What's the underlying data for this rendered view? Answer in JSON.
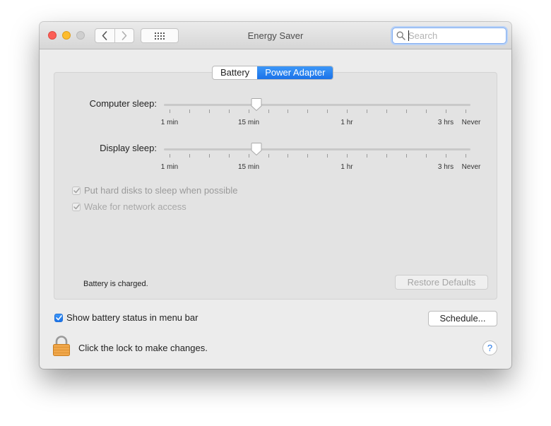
{
  "window": {
    "title": "Energy Saver"
  },
  "search": {
    "placeholder": "Search",
    "value": ""
  },
  "tabs": [
    {
      "label": "Battery",
      "selected": false
    },
    {
      "label": "Power Adapter",
      "selected": true
    }
  ],
  "computer_sleep": {
    "label": "Computer sleep:",
    "tick_labels": [
      "1 min",
      "15 min",
      "1 hr",
      "3 hrs",
      "Never"
    ],
    "value": "15 min"
  },
  "display_sleep": {
    "label": "Display sleep:",
    "tick_labels": [
      "1 min",
      "15 min",
      "1 hr",
      "3 hrs",
      "Never"
    ],
    "value": "15 min"
  },
  "options": [
    {
      "label": "Put hard disks to sleep when possible",
      "checked": true,
      "enabled": false
    },
    {
      "label": "Wake for network access",
      "checked": true,
      "enabled": false
    }
  ],
  "status_text": "Battery is charged.",
  "restore_defaults_label": "Restore Defaults",
  "show_battery_status": {
    "label": "Show battery status in menu bar",
    "checked": true
  },
  "schedule_label": "Schedule...",
  "lock_text": "Click the lock to make changes.",
  "help_label": "?",
  "colors": {
    "accent": "#1b72e8",
    "close": "#fc5f57",
    "minimize": "#fdbc2e",
    "zoom": "#cfcfcf"
  },
  "icons": [
    "back-icon",
    "forward-icon",
    "grid-icon",
    "search-icon",
    "checkmark-icon",
    "lock-icon",
    "help-icon"
  ]
}
